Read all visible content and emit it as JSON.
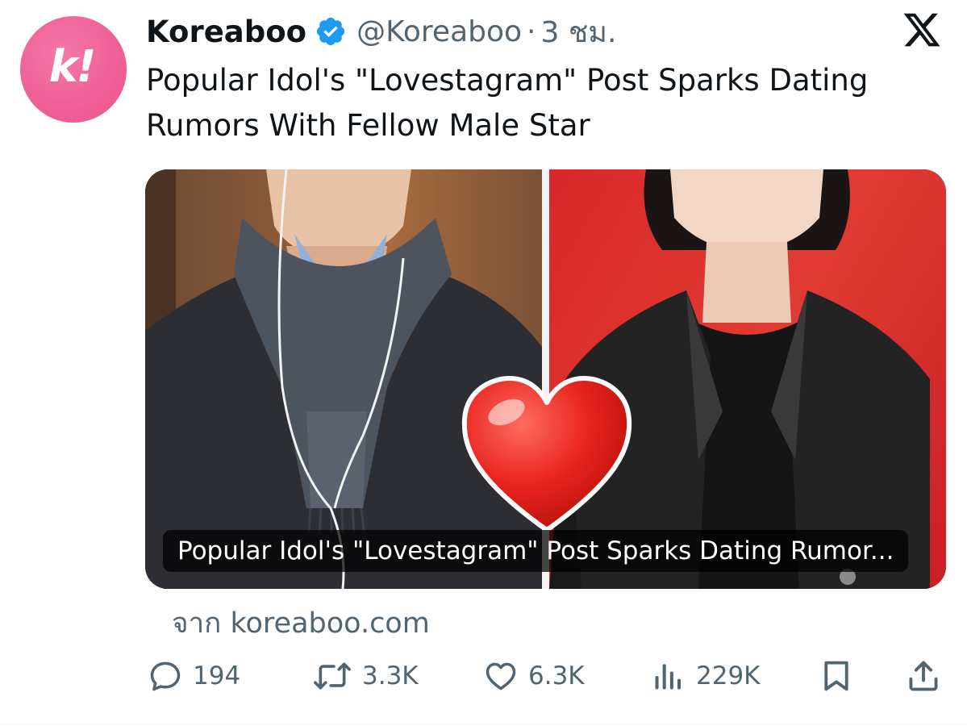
{
  "account": {
    "name": "Koreaboo",
    "handle": "@Koreaboo",
    "separator": "·",
    "time": "3 ชม.",
    "avatar_icon": "koreaboo-k-logo",
    "avatar_letter": "k!",
    "avatar_color": "#ee5f95",
    "verified_color": "#1d9bf0"
  },
  "platform_icon": "x-logo",
  "tweet": {
    "text": "Popular Idol's \"Lovestagram\" Post Sparks Dating Rumors With Fellow Male Star"
  },
  "card": {
    "caption": "Popular Idol's \"Lovestagram\" Post Sparks Dating Rumor...",
    "source": "จาก koreaboo.com",
    "heart_color": "#e8231d"
  },
  "actions": {
    "replies": {
      "icon": "reply-icon",
      "count": "194"
    },
    "retweets": {
      "icon": "retweet-icon",
      "count": "3.3K"
    },
    "likes": {
      "icon": "heart-icon",
      "count": "6.3K"
    },
    "views": {
      "icon": "analytics-icon",
      "count": "229K"
    },
    "bookmark": {
      "icon": "bookmark-icon"
    },
    "share": {
      "icon": "share-icon"
    }
  }
}
